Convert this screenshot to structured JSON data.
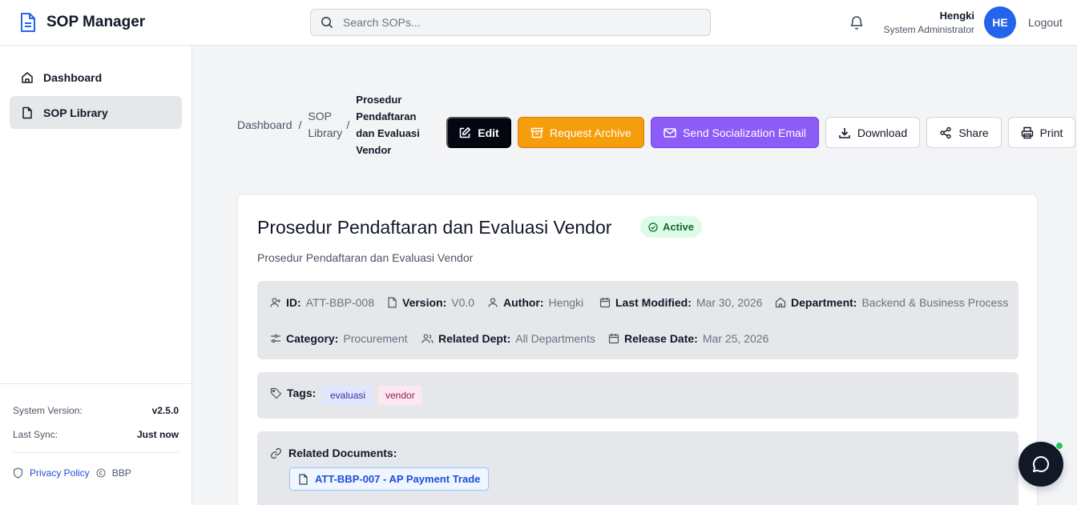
{
  "app": {
    "name": "SOP Manager"
  },
  "search": {
    "placeholder": "Search SOPs..."
  },
  "user": {
    "name": "Hengki",
    "role": "System Administrator",
    "initials": "HE",
    "logout_label": "Logout"
  },
  "sidebar": {
    "items": [
      {
        "label": "Dashboard",
        "icon": "home-icon",
        "active": false
      },
      {
        "label": "SOP Library",
        "icon": "file-icon",
        "active": true
      }
    ],
    "system_version_label": "System Version:",
    "system_version": "v2.5.0",
    "last_sync_label": "Last Sync:",
    "last_sync": "Just now",
    "privacy_label": "Privacy Policy",
    "copyright": "BBP"
  },
  "breadcrumb": {
    "items": [
      "Dashboard",
      "SOP Library"
    ],
    "current": "Prosedur Pendaftaran dan Evaluasi Vendor"
  },
  "actions": {
    "edit": "Edit",
    "archive": "Request Archive",
    "email": "Send Socialization Email",
    "download": "Download",
    "share": "Share",
    "print": "Print"
  },
  "sop": {
    "title": "Prosedur Pendaftaran dan Evaluasi Vendor",
    "status": "Active",
    "description": "Prosedur Pendaftaran dan Evaluasi Vendor",
    "meta": {
      "id_label": "ID:",
      "id": "ATT-BBP-008",
      "version_label": "Version:",
      "version": "V0.0",
      "author_label": "Author:",
      "author": "Hengki",
      "modified_label": "Last Modified:",
      "modified": "Mar 30, 2026",
      "department_label": "Department:",
      "department": "Backend & Business Process",
      "category_label": "Category:",
      "category": "Procurement",
      "related_dept_label": "Related Dept:",
      "related_dept": "All Departments",
      "release_label": "Release Date:",
      "release": "Mar 25, 2026"
    },
    "tags_label": "Tags:",
    "tags": [
      "evaluasi",
      "vendor"
    ],
    "related_label": "Related Documents:",
    "related_documents": [
      "ATT-BBP-007 - AP Payment Trade"
    ]
  },
  "colors": {
    "primary": "#2563eb",
    "archive": "#f59e0b",
    "email": "#8b5cf6",
    "active_bg": "#dcfce7",
    "active_text": "#166534"
  }
}
